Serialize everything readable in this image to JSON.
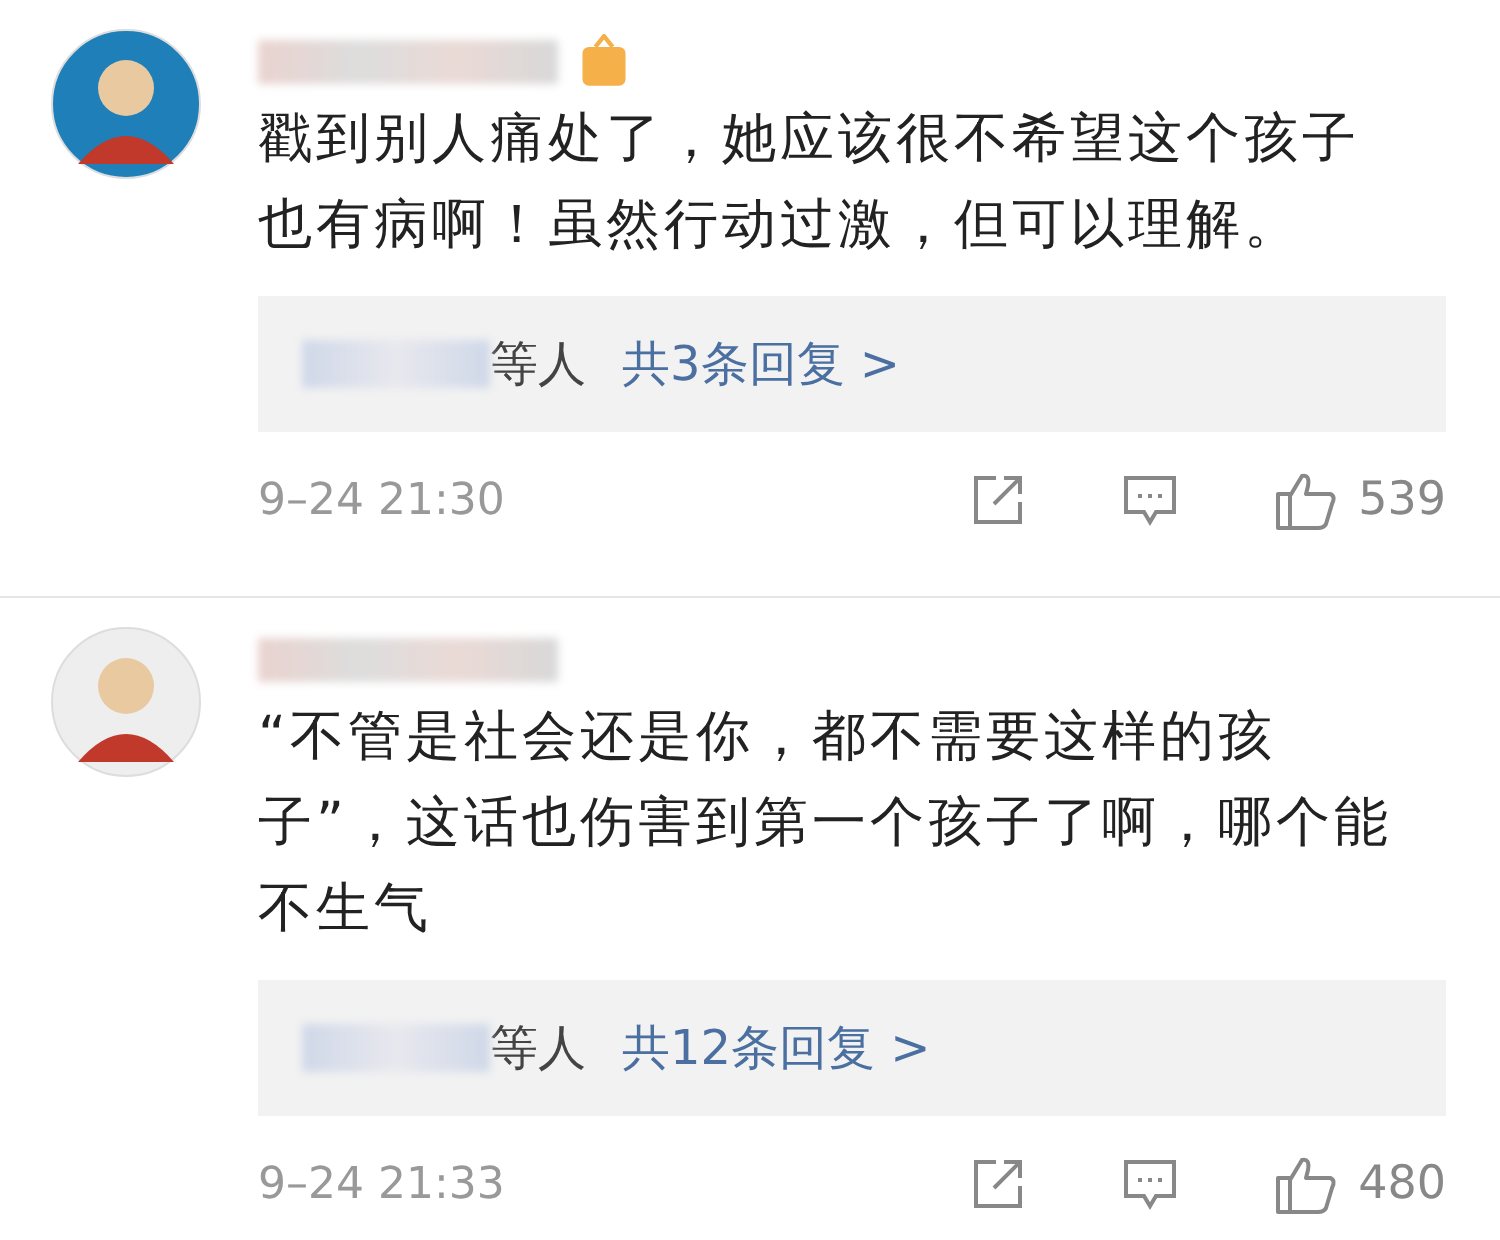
{
  "comments": [
    {
      "avatar": {
        "color": "#1f7fb8"
      },
      "has_badge": true,
      "text": "戳到别人痛处了，她应该很不希望这个孩子也有病啊！虽然行动过激，但可以理解。",
      "replies": {
        "suffix": "等人",
        "link": "共3条回复 >"
      },
      "time": "9–24 21:30",
      "likes": "539"
    },
    {
      "avatar": {
        "color": "#eeeeee"
      },
      "has_badge": false,
      "text": "“不管是社会还是你，都不需要这样的孩子”，这话也伤害到第一个孩子了啊，哪个能不生气",
      "replies": {
        "suffix": "等人",
        "link": "共12条回复 >"
      },
      "time": "9–24 21:33",
      "likes": "480"
    }
  ]
}
